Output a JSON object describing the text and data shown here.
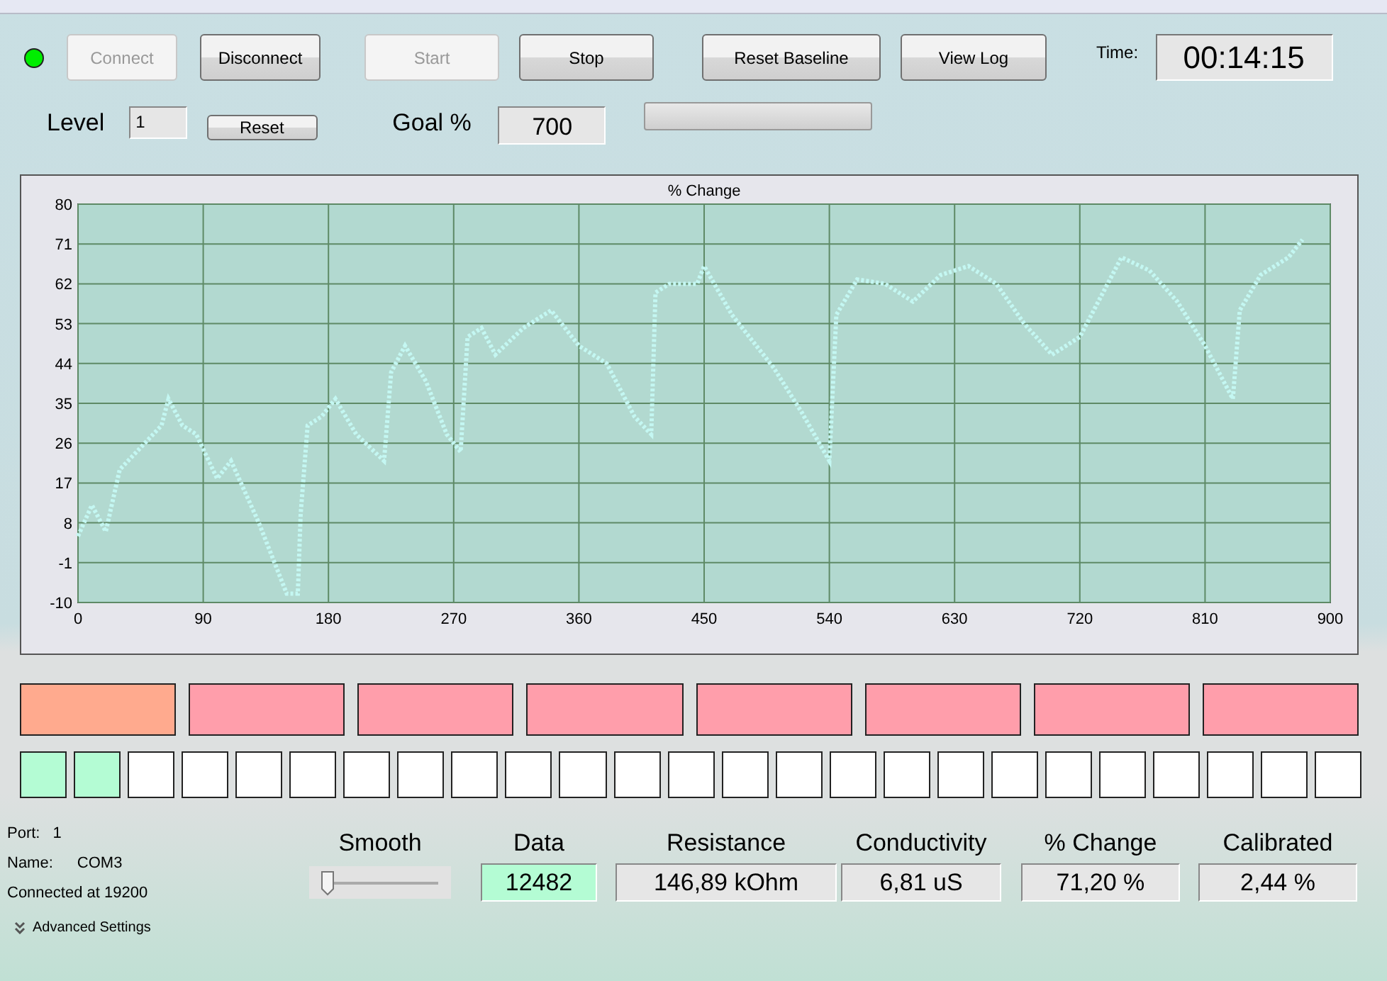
{
  "status_light": {
    "on": true,
    "color": "#00ee00"
  },
  "buttons": [
    {
      "label": "Connect",
      "disabled": true
    },
    {
      "label": "Disconnect",
      "disabled": false
    },
    {
      "label": "Start",
      "disabled": true
    },
    {
      "label": "Stop",
      "disabled": false
    },
    {
      "label": "Reset Baseline",
      "disabled": false
    },
    {
      "label": "View Log",
      "disabled": false
    }
  ],
  "time": {
    "label": "Time:",
    "value": "00:14:15"
  },
  "level": {
    "label": "Level",
    "value": "1",
    "reset": "Reset"
  },
  "goal": {
    "label": "Goal %",
    "value": "700",
    "progress": {
      "level": 0
    }
  },
  "chart": {
    "chart_data": {
      "type": "line",
      "title": "% Change",
      "grid": true,
      "xlim": [
        0,
        900
      ],
      "ylim": [
        -10,
        80
      ],
      "xticks": [
        0,
        90,
        180,
        270,
        360,
        450,
        540,
        630,
        720,
        810,
        900
      ],
      "yticks": [
        -10,
        -1,
        8,
        17,
        26,
        35,
        44,
        53,
        62,
        71,
        80
      ],
      "x": [
        0,
        10,
        20,
        30,
        45,
        60,
        65,
        75,
        85,
        100,
        110,
        130,
        150,
        158,
        160,
        165,
        175,
        185,
        200,
        220,
        225,
        235,
        250,
        265,
        275,
        280,
        290,
        300,
        320,
        340,
        360,
        380,
        400,
        412,
        415,
        425,
        445,
        450,
        470,
        500,
        520,
        540,
        545,
        560,
        580,
        600,
        620,
        640,
        660,
        680,
        700,
        720,
        740,
        750,
        770,
        790,
        810,
        830,
        835,
        850,
        870,
        880
      ],
      "series": [
        {
          "color": "#c4f7f2",
          "line_style": "dotted",
          "values": [
            5,
            12,
            6,
            20,
            25,
            30,
            36,
            30,
            28,
            18,
            22,
            8,
            -8,
            -8,
            10,
            30,
            32,
            36,
            28,
            22,
            42,
            48,
            40,
            28,
            24,
            50,
            52,
            46,
            52,
            56,
            48,
            44,
            32,
            28,
            60,
            62,
            62,
            66,
            55,
            43,
            33,
            22,
            55,
            63,
            62,
            58,
            64,
            66,
            62,
            53,
            46,
            50,
            62,
            68,
            65,
            58,
            48,
            36,
            56,
            64,
            68,
            72
          ]
        }
      ]
    }
  },
  "tiles": [
    {
      "color": "#ffaa8e"
    },
    {
      "color": "#ff9eab"
    },
    {
      "color": "#ff9eab"
    },
    {
      "color": "#ff9eab"
    },
    {
      "color": "#ff9eab"
    },
    {
      "color": "#ff9eab"
    },
    {
      "color": "#ff9eab"
    },
    {
      "color": "#ff9eab"
    }
  ],
  "steps": [
    {
      "color": "#b4fcd4"
    },
    {
      "color": "#b4fcd4"
    },
    {
      "color": "#ffffff"
    },
    {
      "color": "#ffffff"
    },
    {
      "color": "#ffffff"
    },
    {
      "color": "#ffffff"
    },
    {
      "color": "#ffffff"
    },
    {
      "color": "#ffffff"
    },
    {
      "color": "#ffffff"
    },
    {
      "color": "#ffffff"
    },
    {
      "color": "#ffffff"
    },
    {
      "color": "#ffffff"
    },
    {
      "color": "#ffffff"
    },
    {
      "color": "#ffffff"
    },
    {
      "color": "#ffffff"
    },
    {
      "color": "#ffffff"
    },
    {
      "color": "#ffffff"
    },
    {
      "color": "#ffffff"
    },
    {
      "color": "#ffffff"
    },
    {
      "color": "#ffffff"
    },
    {
      "color": "#ffffff"
    },
    {
      "color": "#ffffff"
    },
    {
      "color": "#ffffff"
    },
    {
      "color": "#ffffff"
    },
    {
      "color": "#ffffff"
    }
  ],
  "port": {
    "port_label": "Port:",
    "port": "1",
    "name_label": "Name:",
    "name": "COM3",
    "status": "Connected at 19200",
    "advanced": "Advanced Settings"
  },
  "smooth": {
    "label": "Smooth",
    "level": 0.05
  },
  "readouts": [
    {
      "label": "Data",
      "value": "12482",
      "highlight": true
    },
    {
      "label": "Resistance",
      "value": "146,89 kOhm",
      "highlight": false
    },
    {
      "label": "Conductivity",
      "value": "6,81 uS",
      "highlight": false
    },
    {
      "label": "% Change",
      "value": "71,20 %",
      "highlight": false
    },
    {
      "label": "Calibrated",
      "value": "2,44 %",
      "highlight": false
    }
  ]
}
